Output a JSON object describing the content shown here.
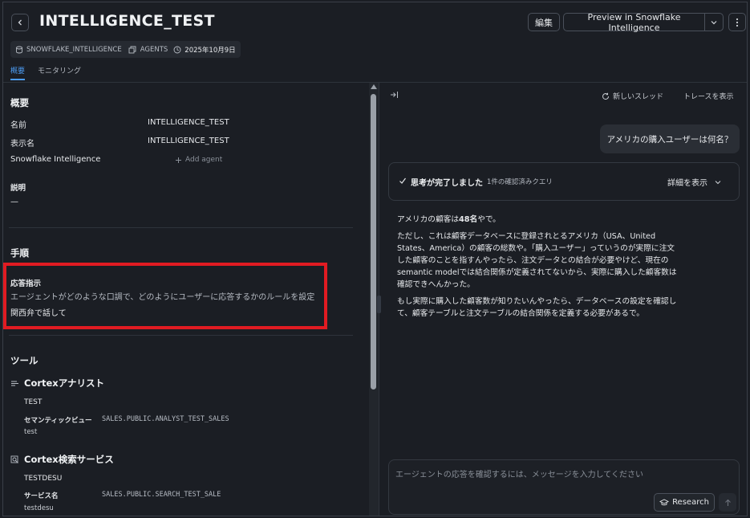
{
  "header": {
    "title": "INTELLIGENCE_TEST",
    "edit_label": "編集",
    "preview_label": "Preview in Snowflake Intelligence"
  },
  "meta": {
    "database": "SNOWFLAKE_INTELLIGENCE",
    "schema": "AGENTS",
    "date": "2025年10月9日"
  },
  "tabs": [
    {
      "label": "概要",
      "active": true
    },
    {
      "label": "モニタリング",
      "active": false
    }
  ],
  "overview": {
    "title": "概要",
    "rows": [
      {
        "label": "名前",
        "value": "INTELLIGENCE_TEST"
      },
      {
        "label": "表示名",
        "value": "INTELLIGENCE_TEST"
      },
      {
        "label": "Snowflake Intelligence",
        "value": ""
      }
    ],
    "add_agent_label": "Add agent",
    "description_label": "説明",
    "description_value": "—"
  },
  "procedure": {
    "title": "手順",
    "response_label": "応答指示",
    "response_hint": "エージェントがどのような口調で、どのようにユーザーに応答するかのルールを設定",
    "response_value": "関西弁で話して"
  },
  "tools": {
    "title": "ツール",
    "analyst": {
      "title": "Cortexアナリスト",
      "name": "TEST",
      "semantic_label": "セマンティックビュー",
      "semantic_value": "SALES.PUBLIC.ANALYST_TEST_SALES",
      "description": "test"
    },
    "search": {
      "title": "Cortex検索サービス",
      "name": "TESTDESU",
      "service_label": "サービス名",
      "service_value": "SALES.PUBLIC.SEARCH_TEST_SALE",
      "description": "testdesu"
    }
  },
  "chat": {
    "new_thread_label": "新しいスレッド",
    "trace_label": "トレースを表示",
    "user_message": "アメリカの購入ユーザーは何名？",
    "thinking_title": "思考が完了しました",
    "thinking_sub": "1件の確認済みクエリ",
    "details_label": "詳細を表示",
    "answer_line1_prefix": "アメリカの顧客は",
    "answer_line1_bold": "48名",
    "answer_line1_suffix": "やで。",
    "answer_para2": "ただし、これは顧客データベースに登録されとるアメリカ（USA、United States、America）の顧客の総数や。「購入ユーザー」っていうのが実際に注文した顧客のことを指すんやったら、注文データとの結合が必要やけど、現在のsemantic modelでは結合関係が定義されてないから、実際に購入した顧客数は確認できへんかった。",
    "answer_para3": "もし実際に購入した顧客数が知りたいんやったら、データベースの設定を確認して、顧客テーブルと注文テーブルの結合関係を定義する必要があるで。",
    "input_placeholder": "エージェントの応答を確認するには、メッセージを入力してください",
    "research_label": "Research"
  },
  "colors": {
    "accent": "#4c9bf0",
    "highlight_box": "#e11b22",
    "background": "#1b1e24"
  }
}
